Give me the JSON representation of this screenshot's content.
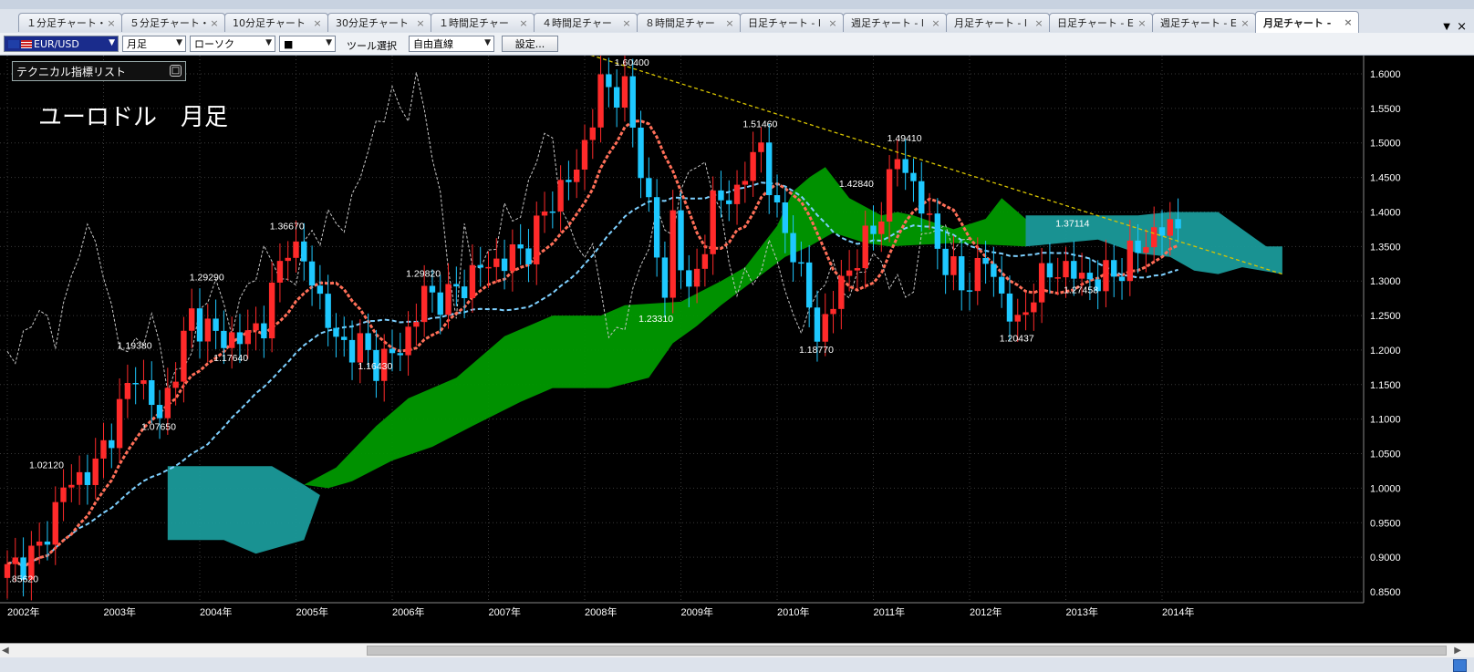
{
  "tabs": [
    {
      "label": "１分足チャート・",
      "active": false
    },
    {
      "label": "５分足チャート・",
      "active": false
    },
    {
      "label": "10分足チャート",
      "active": false
    },
    {
      "label": "30分足チャート",
      "active": false
    },
    {
      "label": "１時間足チャー",
      "active": false
    },
    {
      "label": "４時間足チャー",
      "active": false
    },
    {
      "label": "８時間足チャー",
      "active": false
    },
    {
      "label": "日足チャート - l",
      "active": false
    },
    {
      "label": "週足チャート - l",
      "active": false
    },
    {
      "label": "月足チャート - l",
      "active": false
    },
    {
      "label": "日足チャート - E",
      "active": false
    },
    {
      "label": "週足チャート - E",
      "active": false
    },
    {
      "label": "月足チャート -",
      "active": true
    }
  ],
  "tab_close_glyph": "×",
  "tab_menu_glyph": "▼",
  "tab_close_all_glyph": "×",
  "toolbar": {
    "symbol": "EUR/USD",
    "timeframe": "月足",
    "chart_type": "ローソク",
    "style": "■",
    "tool_label": "ツール選択",
    "tool_value": "自由直線",
    "settings_label": "設定..."
  },
  "indicator_list": {
    "label": "テクニカル指標リスト",
    "button": "□"
  },
  "chart_data": {
    "type": "candlestick",
    "title": "ユーロドル　月足",
    "ylim": [
      0.82,
      1.63
    ],
    "yticks": [
      "1.6000",
      "1.5500",
      "1.5000",
      "1.4500",
      "1.4000",
      "1.3500",
      "1.3000",
      "1.2500",
      "1.2000",
      "1.1500",
      "1.1000",
      "1.0500",
      "1.0000",
      "0.9500",
      "0.9000",
      "0.8500"
    ],
    "xlabels": [
      "2002年",
      "2003年",
      "2004年",
      "2005年",
      "2006年",
      "2007年",
      "2008年",
      "2009年",
      "2010年",
      "2011年",
      "2012年",
      "2013年",
      "2014年"
    ],
    "annotations": [
      {
        "label": ".85620",
        "x": "2002-01",
        "y": 0.8562
      },
      {
        "label": "1.02120",
        "x": "2002-06",
        "y": 1.0212
      },
      {
        "label": "1.19380",
        "x": "2003-05",
        "y": 1.1938
      },
      {
        "label": "1.07650",
        "x": "2003-08",
        "y": 1.0765
      },
      {
        "label": "1.29290",
        "x": "2004-02",
        "y": 1.2929
      },
      {
        "label": "1.17640",
        "x": "2004-05",
        "y": 1.1764
      },
      {
        "label": "1.36670",
        "x": "2004-12",
        "y": 1.3667
      },
      {
        "label": "1.16430",
        "x": "2005-11",
        "y": 1.1643
      },
      {
        "label": "1.29820",
        "x": "2006-05",
        "y": 1.2982
      },
      {
        "label": "1.60400",
        "x": "2008-07",
        "y": 1.604
      },
      {
        "label": "1.23310",
        "x": "2008-10",
        "y": 1.2331
      },
      {
        "label": "1.51460",
        "x": "2009-11",
        "y": 1.5146
      },
      {
        "label": "1.18770",
        "x": "2010-06",
        "y": 1.1877
      },
      {
        "label": "1.42840",
        "x": "2010-11",
        "y": 1.4284
      },
      {
        "label": "1.49410",
        "x": "2011-05",
        "y": 1.4941
      },
      {
        "label": "1.20437",
        "x": "2012-07",
        "y": 1.2044
      },
      {
        "label": "1.37114",
        "x": "2013-02",
        "y": 1.3711
      },
      {
        "label": "1.27458",
        "x": "2013-03",
        "y": 1.2746
      }
    ],
    "trendline": {
      "from": {
        "x": "2008-01",
        "y": 1.63
      },
      "to": {
        "x": "2015-04",
        "y": 1.31
      }
    },
    "colors": {
      "up": "#ff2a2a",
      "down": "#1ec8ff",
      "cloud_bull": "#009900",
      "cloud_bear": "#1a9a9a",
      "base_line": "#ff6f58",
      "conv_line": "#7ed0ff",
      "lag_line": "#c8c8c8",
      "trend": "#d8c400",
      "axis_text": "#ffffff"
    }
  },
  "scrollbar": {
    "left_arrow": "◀",
    "right_arrow": "▶"
  }
}
